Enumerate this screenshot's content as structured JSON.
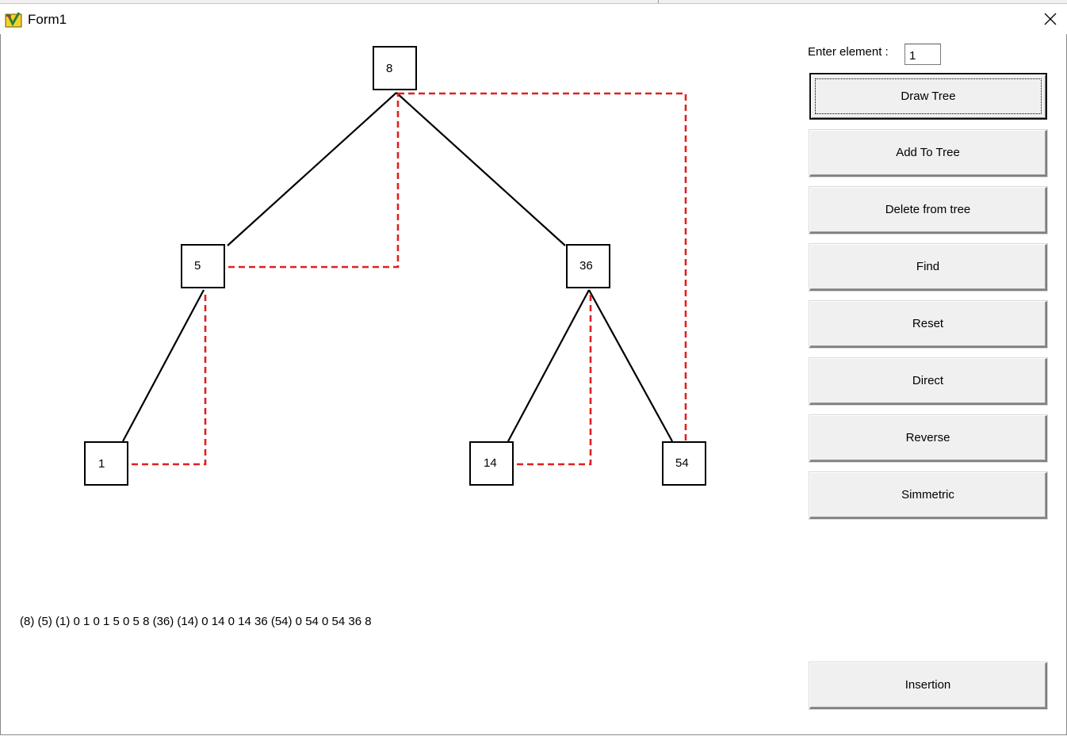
{
  "window": {
    "title": "Form1",
    "icon": "app-icon",
    "close_icon": "close-icon"
  },
  "tree": {
    "nodes": [
      "8",
      "5",
      "36",
      "1",
      "14",
      "54"
    ],
    "edge_color": "#000000",
    "thread_color": "#e02020"
  },
  "traversal_output": "(8) (5) (1) 0 1 0 1 5 0 5 8 (36) (14) 0 14 0 14 36 (54) 0 54 0 54 36 8",
  "controls": {
    "enter_label": "Enter element :",
    "enter_value": "1",
    "buttons": {
      "draw_tree": "Draw Tree",
      "add_to_tree": "Add To Tree",
      "delete_from_tree": "Delete from tree",
      "find": "Find",
      "reset": "Reset",
      "direct": "Direct",
      "reverse": "Reverse",
      "simmetric": "Simmetric",
      "insertion": "Insertion"
    }
  }
}
